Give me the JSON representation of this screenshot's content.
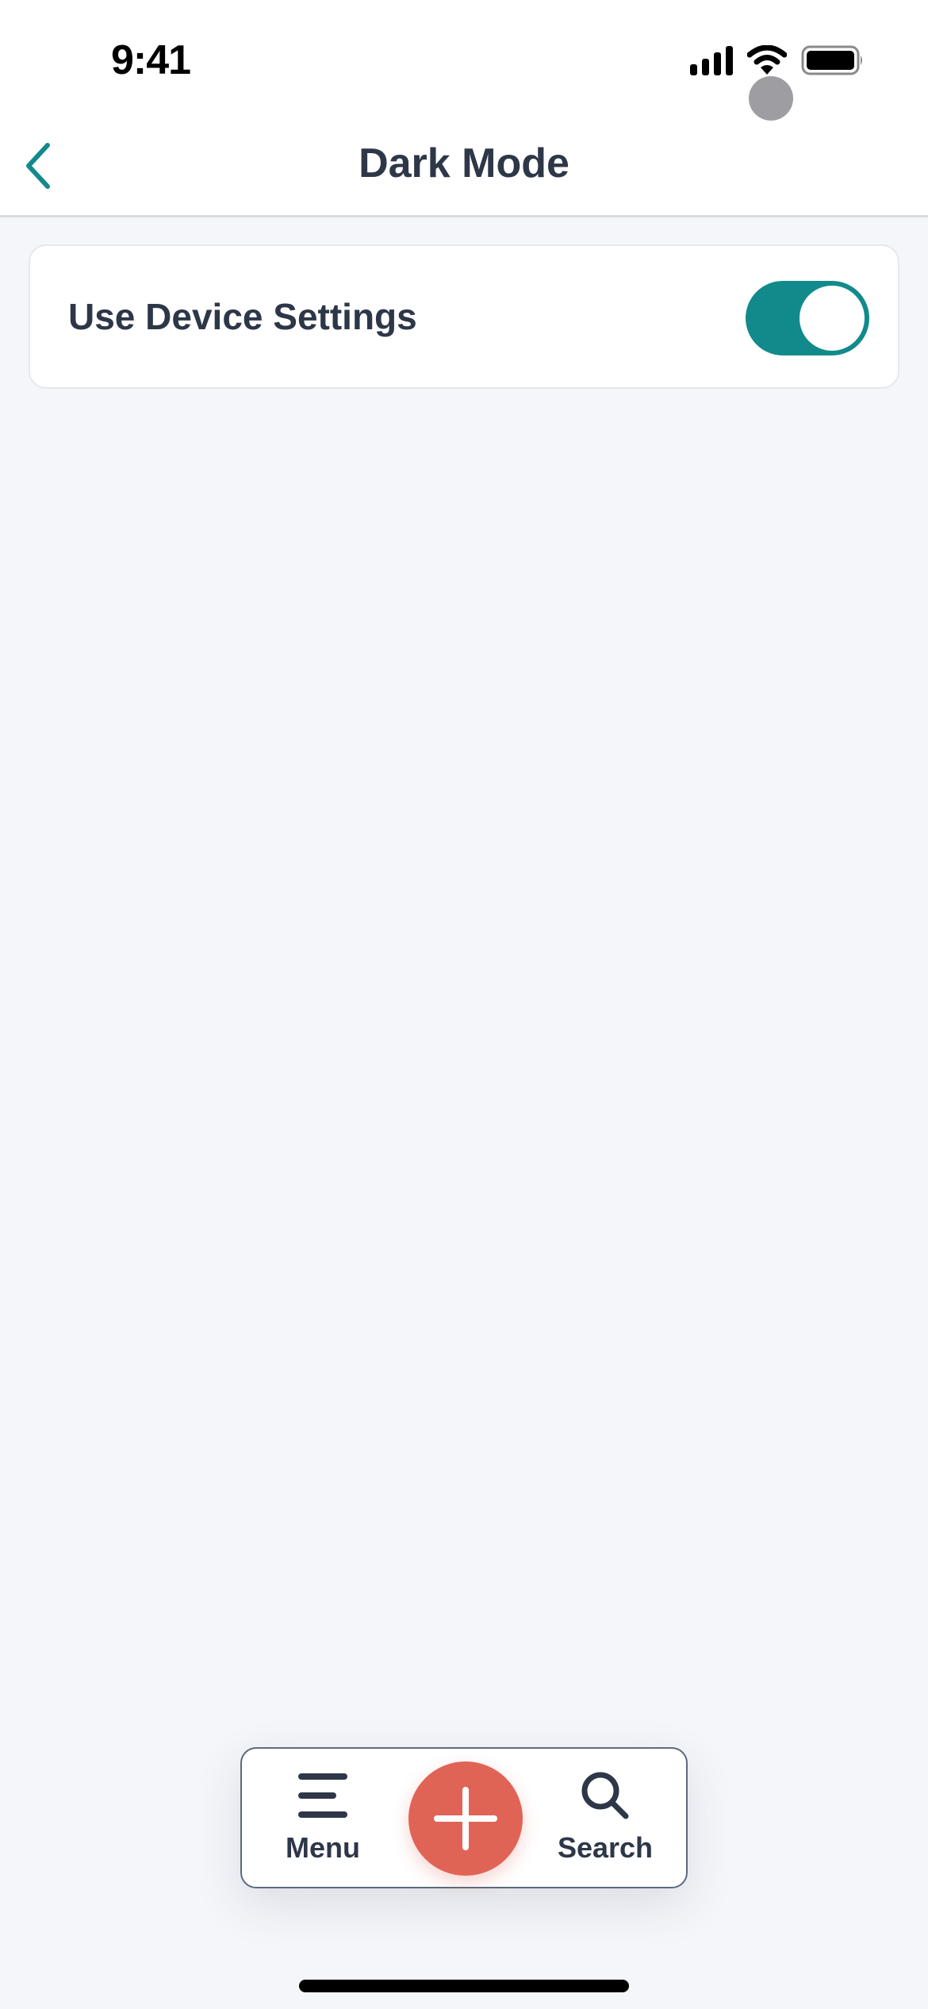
{
  "status_bar": {
    "time": "9:41",
    "icons": [
      "cellular-signal-icon",
      "wifi-icon",
      "battery-icon"
    ]
  },
  "header": {
    "title": "Dark Mode",
    "back_icon": "chevron-left-icon"
  },
  "settings": {
    "items": [
      {
        "label": "Use Device Settings",
        "type": "toggle",
        "value": true
      }
    ]
  },
  "tab_bar": {
    "items": [
      {
        "label": "Menu",
        "icon": "hamburger-menu-icon"
      },
      {
        "label": "",
        "icon": "plus-icon",
        "role": "add"
      },
      {
        "label": "Search",
        "icon": "search-icon"
      }
    ]
  },
  "colors": {
    "accent": "#128a8c",
    "fab": "#e06456",
    "text": "#2d3748",
    "background": "#f5f6fa"
  }
}
